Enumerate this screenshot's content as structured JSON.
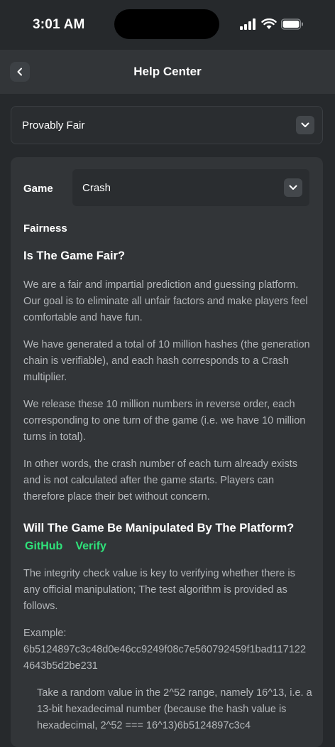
{
  "status": {
    "time": "3:01 AM"
  },
  "nav": {
    "title": "Help Center"
  },
  "category": {
    "selected": "Provably Fair"
  },
  "game": {
    "label": "Game",
    "selected": "Crash"
  },
  "article": {
    "section_title": "Fairness",
    "q1_title": "Is The Game Fair?",
    "p1": "We are a fair and impartial prediction and guessing platform. Our goal is to eliminate all unfair factors and make players feel comfortable and have fun.",
    "p2": "We have generated a total of 10 million hashes (the generation chain is verifiable), and each hash corresponds to a Crash multiplier.",
    "p3": "We release these 10 million numbers in reverse order, each corresponding to one turn of the game (i.e. we have 10 million turns in total).",
    "p4": "In other words, the crash number of each turn already exists and is not calculated after the game starts. Players can therefore place their bet without concern.",
    "q2_title": "Will The Game Be Manipulated By The Platform?",
    "link_github": "GitHub",
    "link_verify": "Verify",
    "p5": "The integrity check value is key to verifying whether there is any official manipulation; The test algorithm is provided as follows.",
    "example_label": "Example:",
    "example_hash": "6b5124897c3c48d0e46cc9249f08c7e560792459f1bad1171224643b5d2be231",
    "p6": "Take a random value in the 2^52 range, namely 16^13, i.e. a 13-bit hexadecimal number (because the hash value is hexadecimal, 2^52 === 16^13)6b5124897c3c4"
  },
  "colors": {
    "accent_green": "#2fe27a",
    "background": "#26292c",
    "card": "#323538"
  }
}
